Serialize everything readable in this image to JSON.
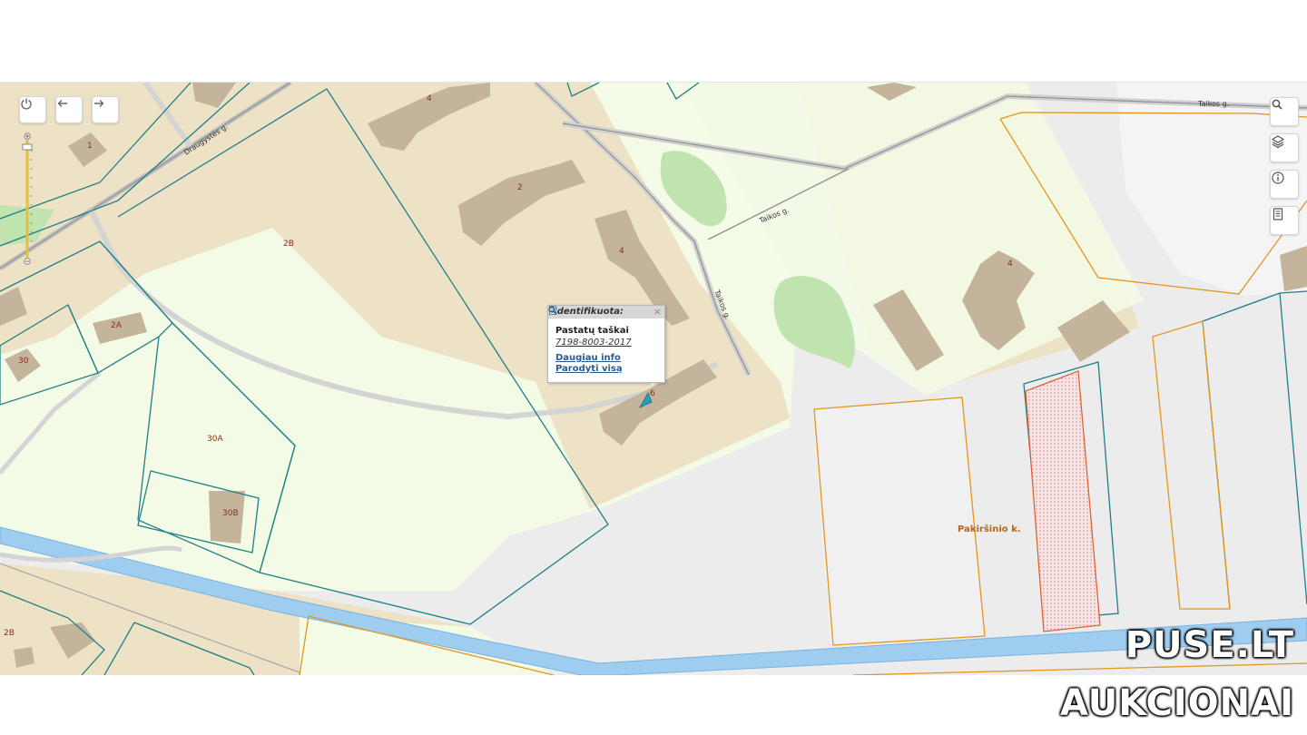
{
  "map": {
    "streets": {
      "draugystes": "Draugystės g.",
      "taikos_1": "Taikos g.",
      "taikos_2": "Taikos g.",
      "taikos_3": "Taikos g."
    },
    "labels": {
      "l_1": "1",
      "l_4a": "4",
      "l_2": "2",
      "l_4b": "4",
      "l_4c": "4",
      "l_2b_parcel": "2B",
      "l_2a": "2A",
      "l_30": "30",
      "l_30a": "30A",
      "l_30b": "30B",
      "l_2b_lower": "2B",
      "l_6": "6",
      "pakirsinio": "Pakiršinio k."
    }
  },
  "controls": {
    "power_icon": "power-icon",
    "back_icon": "arrow-left-icon",
    "forward_icon": "arrow-right-icon",
    "search_icon": "search-icon",
    "layers_icon": "layers-icon",
    "info_icon": "info-icon",
    "legend_icon": "document-icon"
  },
  "popup": {
    "header": "Identifikuota:",
    "close": "×",
    "title": "Pastatų taškai",
    "code": "7198-8003-2017",
    "more_info": "Daugiau info",
    "show_all": "Parodyti visą"
  },
  "watermark": {
    "line1": "PUSE.LT",
    "line2": "AUKCIONAI"
  },
  "colors": {
    "parcel_teal": "#1f7f86",
    "parcel_orange": "#e3961e",
    "built_area": "#ede1c6",
    "green_area": "#f3fbe6",
    "building": "#c4b49c",
    "river": "#9ecdf0"
  }
}
